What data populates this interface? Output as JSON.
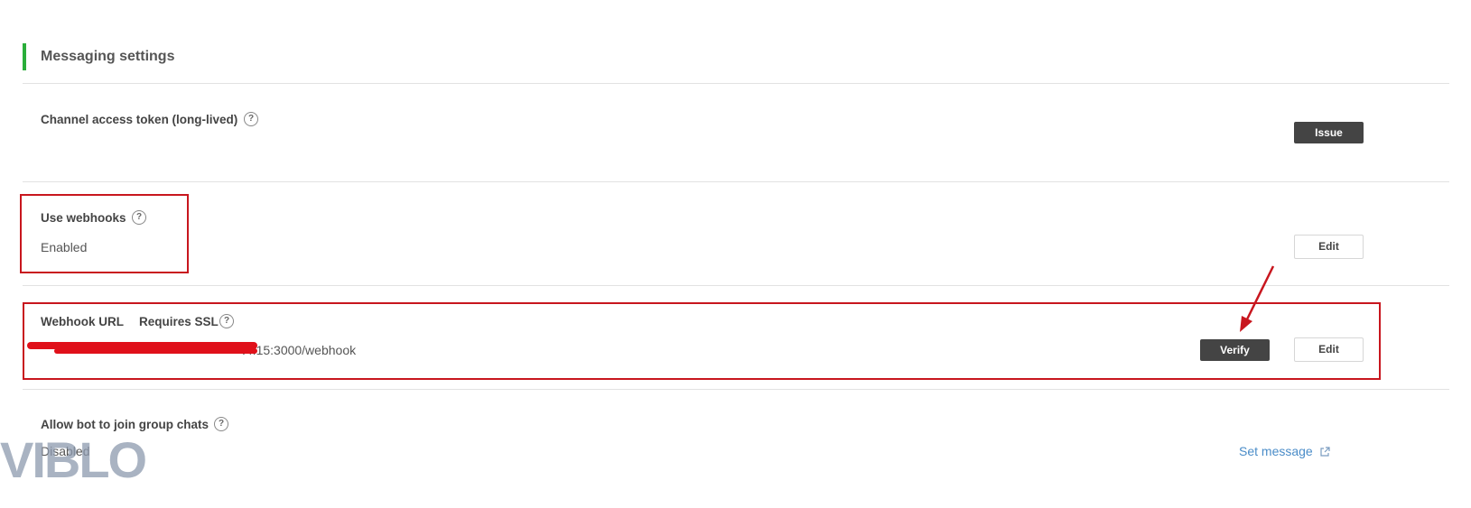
{
  "section": {
    "title": "Messaging settings"
  },
  "channel_token": {
    "label": "Channel access token (long-lived)",
    "issue_label": "Issue"
  },
  "webhooks": {
    "label": "Use webhooks",
    "value": "Enabled",
    "edit_label": "Edit"
  },
  "webhook_url": {
    "label": "Webhook URL",
    "ssl_label": "Requires SSL",
    "value_visible": ".4.15:3000/webhook",
    "verify_label": "Verify",
    "edit_label": "Edit"
  },
  "group_chats": {
    "label": "Allow bot to join group chats",
    "value": "Disabled",
    "link_label": "Set message"
  },
  "help_glyph": "?",
  "watermark": {
    "text": "VIBLO"
  },
  "colors": {
    "accent": "#2aae3a",
    "annotation": "#c8161e",
    "link": "#4a8cc8",
    "dark_button": "#444444"
  }
}
